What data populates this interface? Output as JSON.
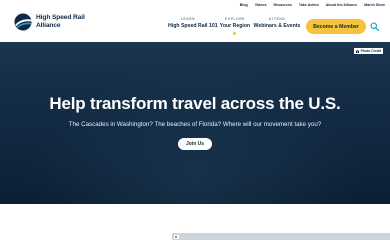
{
  "brand": {
    "line1": "High Speed Rail",
    "line2": "Alliance",
    "logo_icon": "hsra-logo-mark",
    "navy": "#0e2a44",
    "yellow": "#f5c33c",
    "teal": "#1aa7c4"
  },
  "util_nav": [
    "Blog",
    "Videos",
    "Resources",
    "Take Action",
    "About the Alliance",
    "March Store"
  ],
  "main_nav": [
    {
      "kicker": "LEARN",
      "title": "High Speed Rail 101"
    },
    {
      "kicker": "EXPLORE",
      "title": "Your Region"
    },
    {
      "kicker": "ATTEND",
      "title": "Webinars & Events"
    }
  ],
  "cta": {
    "label": "Become a Member"
  },
  "search": {
    "icon": "search-icon"
  },
  "hero": {
    "photo_credit": "Photo Credit",
    "title": "Help transform travel across the U.S.",
    "subtitle": "The Cascades in Washington? The beaches of Florida? Where will our movement take you?",
    "button": "Join Us"
  },
  "media": {
    "icon": "image-placeholder-icon"
  }
}
